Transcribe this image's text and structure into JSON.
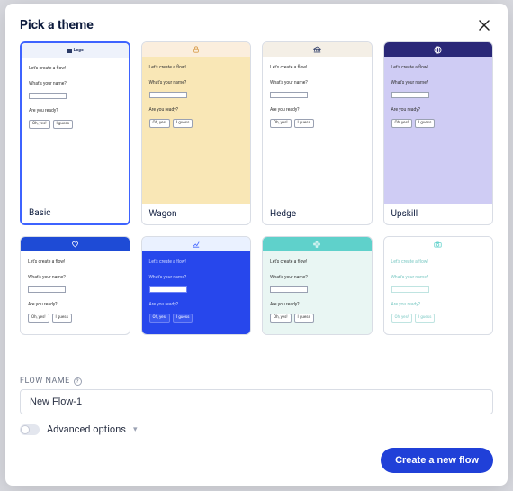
{
  "modal": {
    "title": "Pick a theme"
  },
  "preview": {
    "heading": "Let's create a flow!",
    "q_name": "What's your name?",
    "q_ready": "Are you ready?",
    "btn_yes": "Oh, yes!",
    "btn_guess": "I guess",
    "logo_text": "Logo"
  },
  "themes": {
    "row1": [
      {
        "label": "Basic"
      },
      {
        "label": "Wagon"
      },
      {
        "label": "Hedge"
      },
      {
        "label": "Upskill"
      }
    ]
  },
  "flow": {
    "name_label": "FLOW NAME",
    "name_value": "New Flow-1"
  },
  "advanced": {
    "label": "Advanced options"
  },
  "actions": {
    "create": "Create a new flow"
  }
}
